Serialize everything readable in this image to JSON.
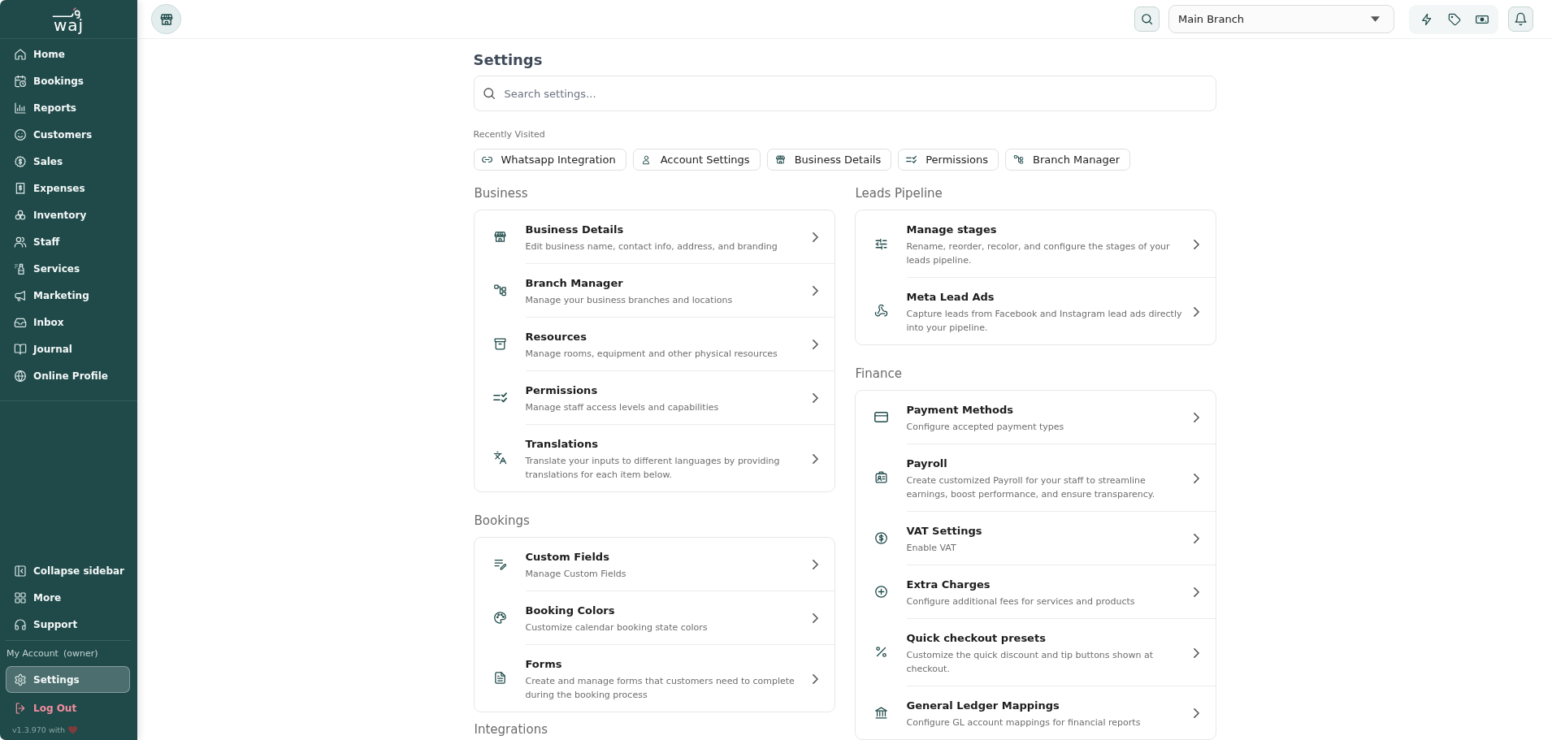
{
  "sidebar": {
    "logo": "waj",
    "nav": [
      {
        "label": "Home",
        "selected": false
      },
      {
        "label": "Bookings",
        "selected": false
      },
      {
        "label": "Reports",
        "selected": false
      },
      {
        "label": "Customers",
        "selected": false
      },
      {
        "label": "Sales",
        "selected": false
      },
      {
        "label": "Expenses",
        "selected": false
      },
      {
        "label": "Inventory",
        "selected": false
      },
      {
        "label": "Staff",
        "selected": false
      },
      {
        "label": "Services",
        "selected": false
      },
      {
        "label": "Marketing",
        "selected": false
      },
      {
        "label": "Inbox",
        "selected": false
      },
      {
        "label": "Journal",
        "selected": false
      },
      {
        "label": "Online Profile",
        "selected": false
      }
    ],
    "tools": [
      {
        "label": "Collapse sidebar"
      },
      {
        "label": "More"
      },
      {
        "label": "Support"
      }
    ],
    "account": {
      "label": "My Account",
      "role": "(owner)",
      "items": [
        {
          "label": "Settings",
          "kind": "link",
          "selected": true
        },
        {
          "label": "Log Out",
          "kind": "logout",
          "selected": false
        }
      ]
    },
    "version": "v1.3.970 with"
  },
  "topbar": {
    "branch": "Main Branch"
  },
  "page": {
    "title": "Settings",
    "search": {
      "placeholder": "Search settings..."
    },
    "recent": {
      "label": "Recently Visited",
      "items": [
        {
          "label": "Whatsapp Integration"
        },
        {
          "label": "Account Settings"
        },
        {
          "label": "Business Details"
        },
        {
          "label": "Permissions"
        },
        {
          "label": "Branch Manager"
        }
      ]
    },
    "columns": [
      {
        "sections": [
          {
            "heading": "Business",
            "items": [
              {
                "title": "Business Details",
                "description": "Edit business name, contact info, address, and branding"
              },
              {
                "title": "Branch Manager",
                "description": "Manage your business branches and locations"
              },
              {
                "title": "Resources",
                "description": "Manage rooms, equipment and other physical resources"
              },
              {
                "title": "Permissions",
                "description": "Manage staff access levels and capabilities"
              },
              {
                "title": "Translations",
                "description": "Translate your inputs to different languages by providing translations for each item below."
              }
            ]
          },
          {
            "heading": "Bookings",
            "items": [
              {
                "title": "Custom Fields",
                "description": "Manage Custom Fields"
              },
              {
                "title": "Booking Colors",
                "description": "Customize calendar booking state colors"
              },
              {
                "title": "Forms",
                "description": "Create and manage forms that customers need to complete during the booking process"
              }
            ]
          },
          {
            "heading": "Integrations"
          }
        ]
      },
      {
        "sections": [
          {
            "heading": "Leads Pipeline",
            "items": [
              {
                "title": "Manage stages",
                "description": "Rename, reorder, recolor, and configure the stages of your leads pipeline."
              },
              {
                "title": "Meta Lead Ads",
                "description": "Capture leads from Facebook and Instagram lead ads directly into your pipeline."
              }
            ]
          },
          {
            "heading": "Finance",
            "items": [
              {
                "title": "Payment Methods",
                "description": "Configure accepted payment types"
              },
              {
                "title": "Payroll",
                "description": "Create customized Payroll for your staff to streamline earnings, boost performance, and ensure transparency."
              },
              {
                "title": "VAT Settings",
                "description": "Enable VAT"
              },
              {
                "title": "Extra Charges",
                "description": "Configure additional fees for services and products"
              },
              {
                "title": "Quick checkout presets",
                "description": "Customize the quick discount and tip buttons shown at checkout."
              },
              {
                "title": "General Ledger Mappings",
                "description": "Configure GL account mappings for financial reports"
              }
            ]
          }
        ]
      }
    ]
  }
}
